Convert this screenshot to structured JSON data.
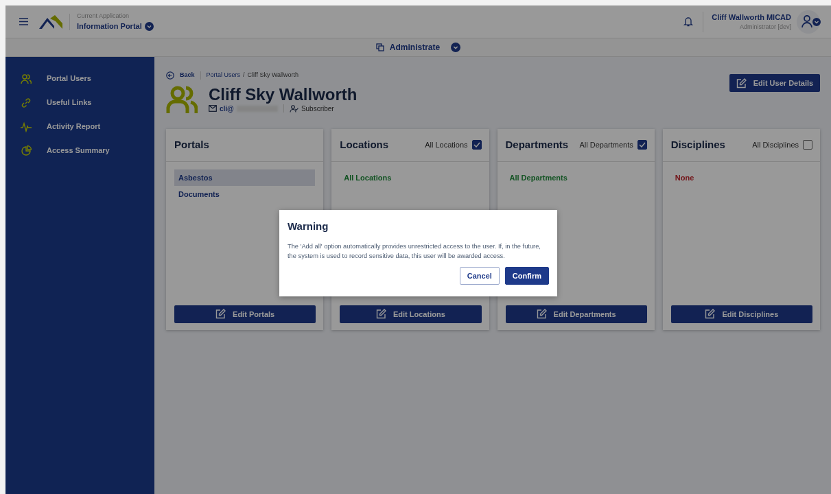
{
  "header": {
    "app_caption": "Current Application",
    "app_name": "Information Portal",
    "user_name": "Cliff Wallworth MICAD",
    "user_role": "Administrator [dev]"
  },
  "subnav": {
    "label": "Administrate"
  },
  "sidebar": {
    "items": [
      {
        "label": "Portal Users",
        "kind": "users"
      },
      {
        "label": "Useful Links",
        "kind": "link"
      },
      {
        "label": "Activity Report",
        "kind": "pulse"
      },
      {
        "label": "Access Summary",
        "kind": "pie"
      }
    ]
  },
  "breadcrumb": {
    "back": "Back",
    "items": [
      "Portal Users",
      "Cliff Sky Wallworth"
    ],
    "separator": "/"
  },
  "edit_button": "Edit User Details",
  "profile": {
    "name": "Cliff Sky Wallworth",
    "email": "cli@",
    "role": "Subscriber"
  },
  "cards": [
    {
      "title": "Portals",
      "items": [
        {
          "label": "Asbestos",
          "kind": "portal",
          "selected": true
        },
        {
          "label": "Documents",
          "kind": "portal",
          "selected": false
        }
      ],
      "button": "Edit Portals"
    },
    {
      "title": "Locations",
      "toggle": {
        "label": "All Locations",
        "checked": true
      },
      "items": [
        {
          "label": "All Locations",
          "kind": "all"
        }
      ],
      "button": "Edit Locations"
    },
    {
      "title": "Departments",
      "toggle": {
        "label": "All Departments",
        "checked": true
      },
      "items": [
        {
          "label": "All Departments",
          "kind": "all"
        }
      ],
      "button": "Edit Departments"
    },
    {
      "title": "Disciplines",
      "toggle": {
        "label": "All Disciplines",
        "checked": false
      },
      "items": [
        {
          "label": "None",
          "kind": "none"
        }
      ],
      "button": "Edit Disciplines"
    }
  ],
  "modal": {
    "title": "Warning",
    "message": "The 'Add all' option automatically provides unrestricted access to the user. If, in the future, the system is used to record sensitive data, this user will be awarded access.",
    "buttons": [
      {
        "label": "Cancel",
        "kind": "secondary"
      },
      {
        "label": "Confirm",
        "kind": "primary"
      }
    ]
  }
}
